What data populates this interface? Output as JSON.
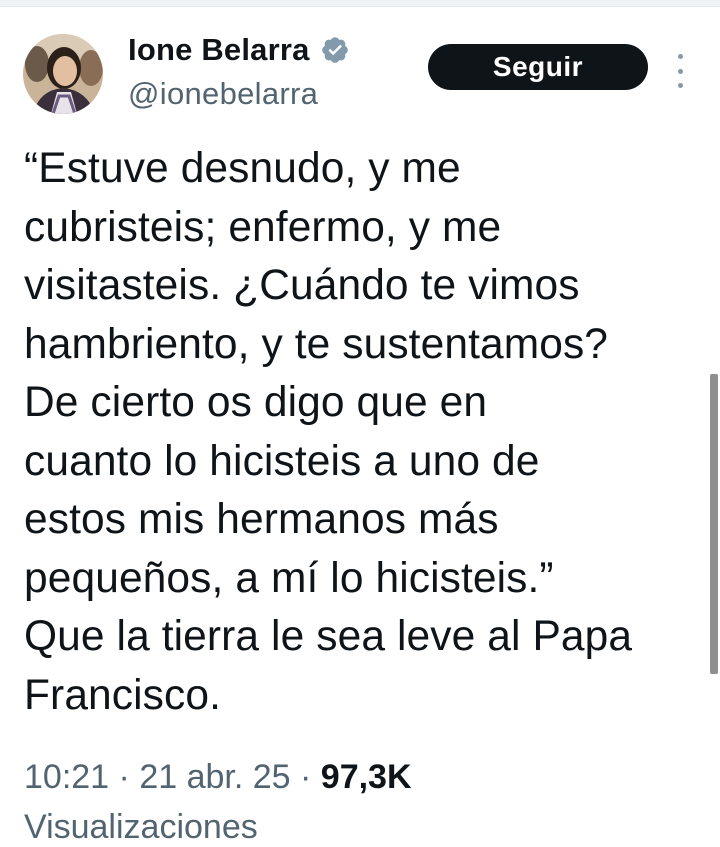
{
  "author": {
    "display_name": "Ione Belarra",
    "handle": "@ionebelarra",
    "verified": true
  },
  "actions": {
    "follow_label": "Seguir",
    "more_icon": "more-vertical-icon"
  },
  "tweet": {
    "text": "“Estuve desnudo, y me\ncubristeis; enfermo, y me\nvisitasteis. ¿Cuándo te vimos\nhambriento, y te sustentamos?\nDe cierto os digo que en\ncuanto lo hicisteis a uno de\nestos mis hermanos más\npequeños, a mí lo hicisteis.”\nQue la tierra le sea leve al Papa\nFrancisco."
  },
  "meta": {
    "time": "10:21",
    "sep1": " · ",
    "date": "21 abr. 25",
    "sep2": " · ",
    "views": "97,3K",
    "views_label": "Visualizaciones"
  },
  "colors": {
    "text": "#0f1419",
    "secondary": "#536471",
    "verified": "#829aab",
    "button_bg": "#0f1419",
    "button_text": "#ffffff"
  }
}
